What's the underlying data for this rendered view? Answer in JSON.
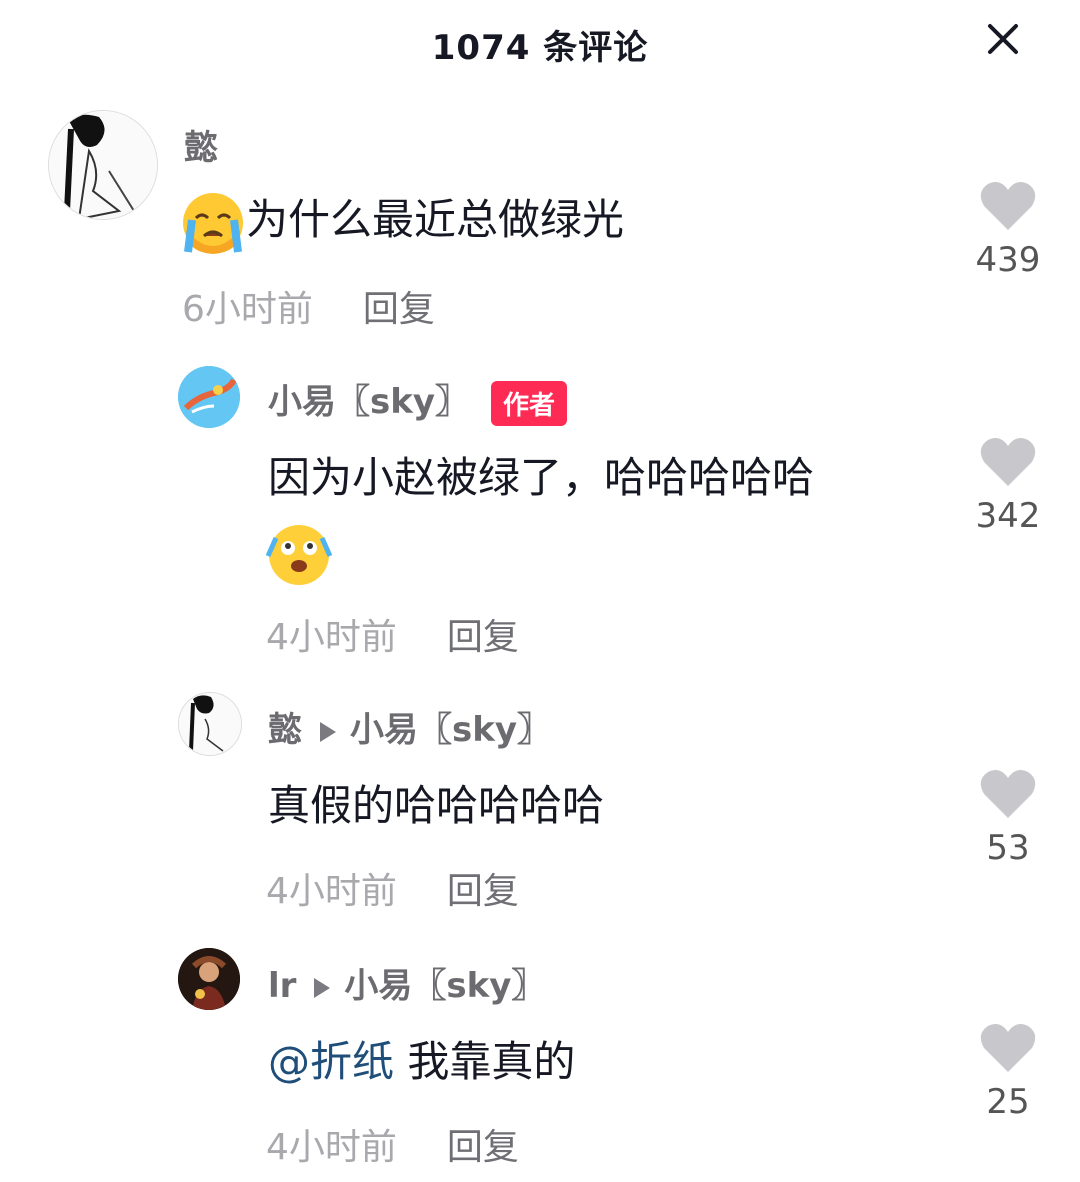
{
  "header": {
    "title": "1074 条评论",
    "close_icon": "close-icon"
  },
  "colors": {
    "author_badge": "#fe2c55",
    "mention": "#1f4e79",
    "meta": "#a8a8ad",
    "like_icon": "#c8c8cc"
  },
  "comments": [
    {
      "user": "懿",
      "emoji": "crying-face-emoji",
      "text": "为什么最近总做绿光",
      "time": "6小时前",
      "reply": "回复",
      "likes": "439"
    },
    {
      "user": "小易〖sky〗",
      "badge": "作者",
      "text": "因为小赵被绿了，哈哈哈哈哈",
      "emoji": "laughing-tears-emoji",
      "time": "4小时前",
      "reply": "回复",
      "likes": "342"
    },
    {
      "user": "懿",
      "reply_to": "小易〖sky〗",
      "text": "真假的哈哈哈哈哈",
      "time": "4小时前",
      "reply": "回复",
      "likes": "53"
    },
    {
      "user": "lr",
      "reply_to": "小易〖sky〗",
      "mention": "@折纸",
      "text": " 我靠真的",
      "time": "4小时前",
      "reply": "回复",
      "likes": "25"
    }
  ]
}
